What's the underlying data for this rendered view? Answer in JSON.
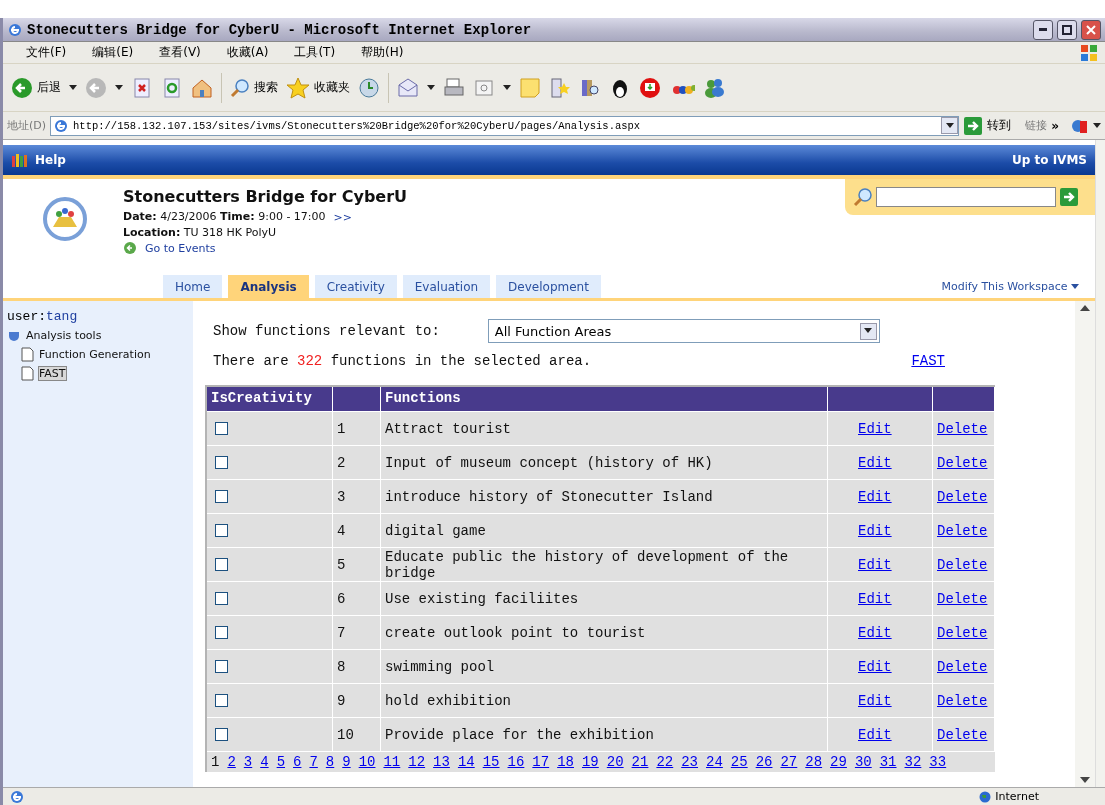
{
  "window": {
    "title": "Stonecutters Bridge for CyberU - Microsoft Internet Explorer"
  },
  "menu": [
    "文件(F)",
    "编辑(E)",
    "查看(V)",
    "收藏(A)",
    "工具(T)",
    "帮助(H)"
  ],
  "toolbar": {
    "back": "后退",
    "search": "搜索",
    "favorites": "收藏夹"
  },
  "address": {
    "label": "地址(D)",
    "url": "http://158.132.107.153/sites/ivms/Stonecutters%20Bridge%20for%20CyberU/pages/Analysis.aspx",
    "go": "转到",
    "links": "链接",
    "more": "»"
  },
  "topbar": {
    "help": "Help",
    "up": "Up to IVMS"
  },
  "header": {
    "title": "Stonecutters Bridge for CyberU",
    "date_label": "Date:",
    "date": "4/23/2006",
    "time_label": "Time:",
    "time": "9:00 - 17:00",
    "more": ">>",
    "location_label": "Location:",
    "location": "TU 318 HK PolyU",
    "events": "Go to Events"
  },
  "tabs": [
    {
      "label": "Home",
      "selected": false
    },
    {
      "label": "Analysis",
      "selected": true
    },
    {
      "label": "Creativity",
      "selected": false
    },
    {
      "label": "Evaluation",
      "selected": false
    },
    {
      "label": "Development",
      "selected": false
    }
  ],
  "modify": "Modify This Workspace",
  "sidebar": {
    "user_label": "user:",
    "user": "tang",
    "tree": [
      {
        "label": "Analysis tools",
        "children": [
          {
            "label": "Function Generation",
            "selected": false
          },
          {
            "label": "FAST",
            "selected": true
          }
        ]
      }
    ]
  },
  "filter": {
    "label": "Show functions relevant to:",
    "value": "All Function Areas"
  },
  "summary": {
    "before": "There are",
    "count": "322",
    "after": "functions in the selected area.",
    "link": "FAST"
  },
  "table": {
    "columns": [
      "IsCreativity",
      "Functions"
    ],
    "rows": [
      {
        "checked": false,
        "num": "1",
        "function": "Attract tourist",
        "edit": "Edit",
        "delete": "Delete"
      },
      {
        "checked": false,
        "num": "2",
        "function": "Input of museum concept (history of HK)",
        "edit": "Edit",
        "delete": "Delete"
      },
      {
        "checked": false,
        "num": "3",
        "function": "introduce history of Stonecutter Island",
        "edit": "Edit",
        "delete": "Delete"
      },
      {
        "checked": false,
        "num": "4",
        "function": "digital game",
        "edit": "Edit",
        "delete": "Delete"
      },
      {
        "checked": false,
        "num": "5",
        "function": "Educate public the history of development of the bridge",
        "edit": "Edit",
        "delete": "Delete"
      },
      {
        "checked": false,
        "num": "6",
        "function": "Use existing faciliites",
        "edit": "Edit",
        "delete": "Delete"
      },
      {
        "checked": false,
        "num": "7",
        "function": "create outlook point to tourist",
        "edit": "Edit",
        "delete": "Delete"
      },
      {
        "checked": false,
        "num": "8",
        "function": "swimming pool",
        "edit": "Edit",
        "delete": "Delete"
      },
      {
        "checked": false,
        "num": "9",
        "function": "hold exhibition",
        "edit": "Edit",
        "delete": "Delete"
      },
      {
        "checked": false,
        "num": "10",
        "function": "Provide place for the exhibition",
        "edit": "Edit",
        "delete": "Delete"
      }
    ],
    "pages": [
      {
        "label": "1",
        "selected": true
      },
      {
        "label": "2",
        "selected": false
      },
      {
        "label": "3",
        "selected": false
      },
      {
        "label": "4",
        "selected": false
      },
      {
        "label": "5",
        "selected": false
      },
      {
        "label": "6",
        "selected": false
      },
      {
        "label": "7",
        "selected": false
      },
      {
        "label": "8",
        "selected": false
      },
      {
        "label": "9",
        "selected": false
      },
      {
        "label": "10",
        "selected": false
      },
      {
        "label": "11",
        "selected": false
      },
      {
        "label": "12",
        "selected": false
      },
      {
        "label": "13",
        "selected": false
      },
      {
        "label": "14",
        "selected": false
      },
      {
        "label": "15",
        "selected": false
      },
      {
        "label": "16",
        "selected": false
      },
      {
        "label": "17",
        "selected": false
      },
      {
        "label": "18",
        "selected": false
      },
      {
        "label": "19",
        "selected": false
      },
      {
        "label": "20",
        "selected": false
      },
      {
        "label": "21",
        "selected": false
      },
      {
        "label": "22",
        "selected": false
      },
      {
        "label": "23",
        "selected": false
      },
      {
        "label": "24",
        "selected": false
      },
      {
        "label": "25",
        "selected": false
      },
      {
        "label": "26",
        "selected": false
      },
      {
        "label": "27",
        "selected": false
      },
      {
        "label": "28",
        "selected": false
      },
      {
        "label": "29",
        "selected": false
      },
      {
        "label": "30",
        "selected": false
      },
      {
        "label": "31",
        "selected": false
      },
      {
        "label": "32",
        "selected": false
      },
      {
        "label": "33",
        "selected": false
      }
    ]
  },
  "status": {
    "zone": "Internet"
  }
}
